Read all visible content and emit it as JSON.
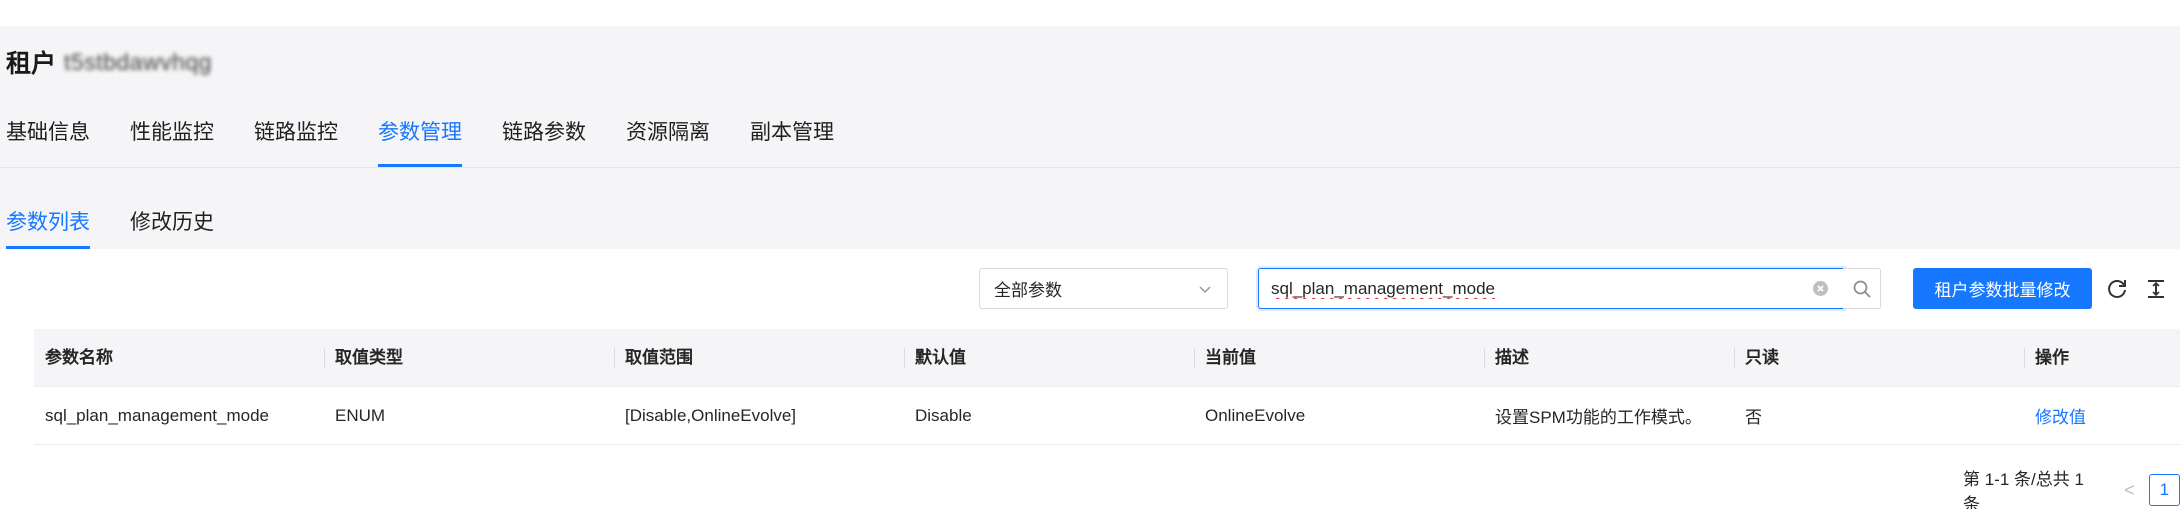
{
  "header": {
    "title_label": "租户",
    "tenant_name": "t5stbdawvhqg"
  },
  "main_tabs": [
    {
      "label": "基础信息",
      "active": false
    },
    {
      "label": "性能监控",
      "active": false
    },
    {
      "label": "链路监控",
      "active": false
    },
    {
      "label": "参数管理",
      "active": true
    },
    {
      "label": "链路参数",
      "active": false
    },
    {
      "label": "资源隔离",
      "active": false
    },
    {
      "label": "副本管理",
      "active": false
    }
  ],
  "sub_tabs": [
    {
      "label": "参数列表",
      "active": true
    },
    {
      "label": "修改历史",
      "active": false
    }
  ],
  "toolbar": {
    "filter_selected": "全部参数",
    "search_value": "sql_plan_management_mode",
    "batch_button": "租户参数批量修改"
  },
  "table": {
    "columns": [
      "参数名称",
      "取值类型",
      "取值范围",
      "默认值",
      "当前值",
      "描述",
      "只读",
      "操作"
    ],
    "rows": [
      {
        "name": "sql_plan_management_mode",
        "type": "ENUM",
        "range": "[Disable,OnlineEvolve]",
        "default": "Disable",
        "current": "OnlineEvolve",
        "description": "设置SPM功能的工作模式。",
        "readonly": "否",
        "action": "修改值"
      }
    ]
  },
  "pagination": {
    "summary": "第 1-1 条/总共 1 条",
    "current_page": "1"
  },
  "colors": {
    "accent": "#1677ff",
    "header_bg": "#f5f5f7"
  }
}
